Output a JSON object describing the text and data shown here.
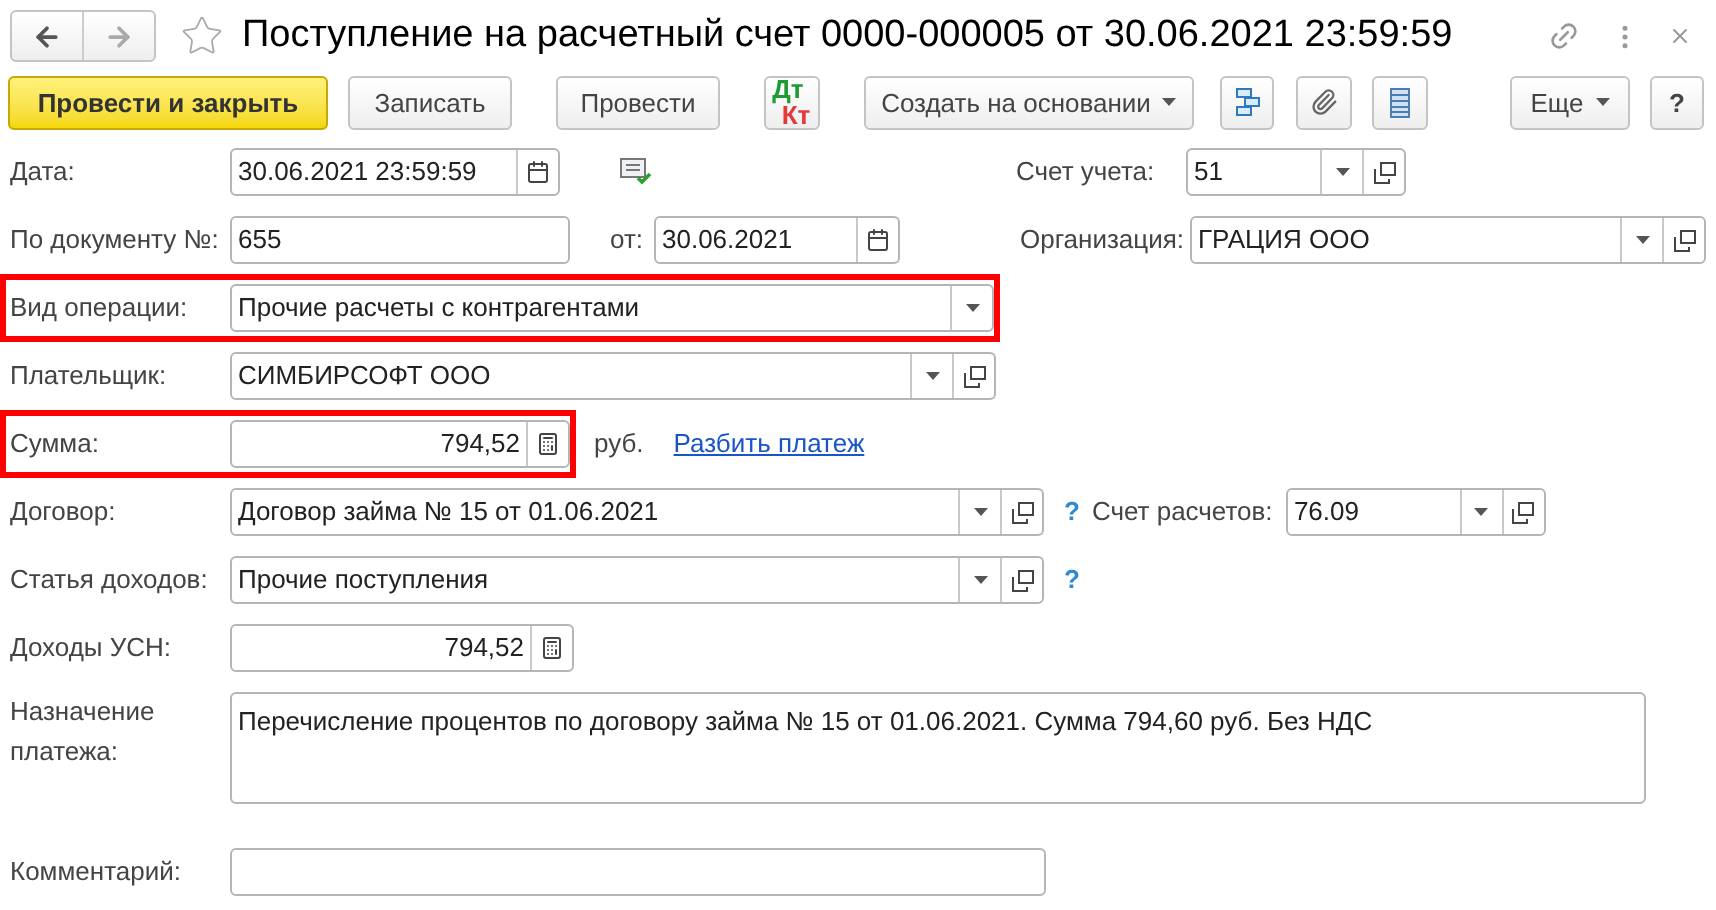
{
  "window": {
    "title": "Поступление на расчетный счет 0000-000005 от 30.06.2021 23:59:59",
    "favorite": false
  },
  "toolbar": [
    {
      "kind": "primary",
      "label": "Провести и закрыть"
    },
    {
      "kind": "plain",
      "label": "Записать"
    },
    {
      "kind": "plain",
      "label": "Провести"
    },
    {
      "kind": "dtkt",
      "label": "Дт",
      "label2": "Кт"
    },
    {
      "kind": "menu",
      "label": "Создать на основании"
    },
    {
      "kind": "structure"
    },
    {
      "kind": "clip"
    },
    {
      "kind": "list"
    },
    {
      "kind": "menu",
      "label": "Еще"
    },
    {
      "kind": "plain",
      "label": "?"
    }
  ],
  "fields": {
    "date": {
      "label": "Дата:",
      "value": "30.06.2021 23:59:59",
      "highlighted": false
    },
    "account": {
      "label": "Счет учета:",
      "value": "51"
    },
    "doc_number": {
      "label": "По документу №:",
      "value": "655",
      "highlighted": false
    },
    "doc_date": {
      "label": "от:",
      "value": "30.06.2021"
    },
    "organization": {
      "label": "Организация:",
      "value": "ГРАЦИЯ ООО"
    },
    "operation": {
      "label": "Вид операции:",
      "value": "Прочие расчеты с контрагентами",
      "highlighted": true
    },
    "payer": {
      "label": "Плательщик:",
      "value": "СИМБИРСОФТ ООО",
      "highlighted": false
    },
    "amount": {
      "label": "Сумма:",
      "value": "794,52",
      "highlighted": true,
      "currency": "руб.",
      "link": "Разбить платеж"
    },
    "contract": {
      "label": "Договор:",
      "value": "Договор займа № 15 от 01.06.2021",
      "help": "?",
      "highlighted": false
    },
    "settlement_account": {
      "label": "Счет расчетов:",
      "value": "76.09"
    },
    "income_item": {
      "label": "Статья доходов:",
      "value": "Прочие поступления",
      "help": "?",
      "highlighted": false
    },
    "usn_income": {
      "label": "Доходы УСН:",
      "value": "794,52",
      "highlighted": false
    },
    "purpose": {
      "label": "Назначение платежа:",
      "value": "Перечисление процентов по договору займа № 15 от 01.06.2021. Сумма 794,60 руб. Без НДС",
      "highlighted": false
    },
    "comment": {
      "label": "Комментарий:",
      "highlighted": false
    }
  }
}
